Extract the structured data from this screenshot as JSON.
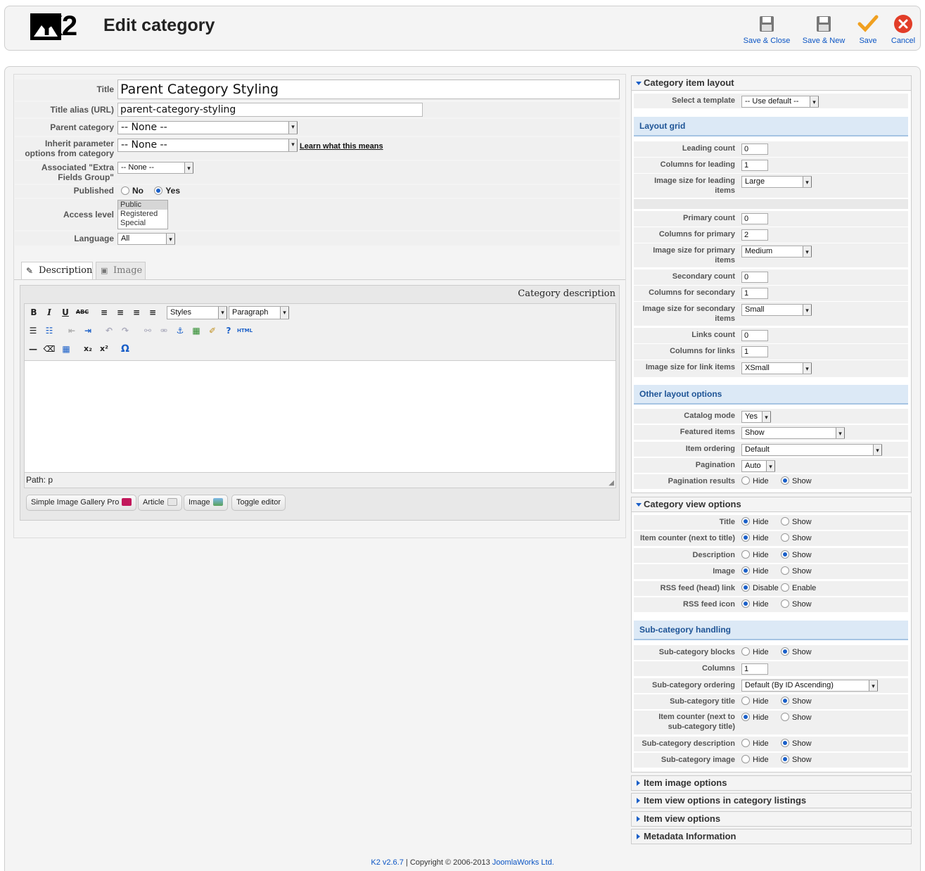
{
  "app": {
    "logo_text": "K2",
    "page_title": "Edit category"
  },
  "toolbar": [
    {
      "label": "Save & Close",
      "icon": "disk-icon"
    },
    {
      "label": "Save & New",
      "icon": "disk-icon"
    },
    {
      "label": "Save",
      "icon": "checkmark-icon"
    },
    {
      "label": "Cancel",
      "icon": "close-icon"
    }
  ],
  "colors": {
    "link": "#0b55c4",
    "radio_on": "#1a5fc8",
    "section_bg": "#dce9f6",
    "section_text": "#1e5496"
  },
  "form": {
    "title_label": "Title",
    "title_value": "Parent Category Styling",
    "alias_label": "Title alias (URL)",
    "alias_value": "parent-category-styling",
    "parent_label": "Parent category",
    "parent_value": "-- None --",
    "inherit_label_1": "Inherit parameter",
    "inherit_label_2": "options from category",
    "inherit_value": "-- None --",
    "learn_link": "Learn what this means",
    "extra_label_1": "Associated \"Extra",
    "extra_label_2": "Fields Group\"",
    "extra_value": "-- None --",
    "published_label": "Published",
    "published_no": "No",
    "published_yes": "Yes",
    "access_label": "Access level",
    "access_options": [
      "Public",
      "Registered",
      "Special"
    ],
    "language_label": "Language",
    "language_value": "All"
  },
  "tabs": {
    "description": "Description",
    "image": "Image"
  },
  "editor": {
    "desc_label": "Category description",
    "styles": "Styles",
    "format": "Paragraph",
    "path": "Path: p",
    "buttons": [
      "Simple Image Gallery Pro",
      "Article",
      "Image",
      "Toggle editor"
    ],
    "html_btn": "HTML"
  },
  "right": {
    "item_layout": {
      "header": "Category item layout",
      "template_label": "Select a template",
      "template_value": "-- Use default --"
    },
    "layout_grid": {
      "header": "Layout grid",
      "rows": [
        {
          "label": "Leading count",
          "type": "input",
          "value": "0"
        },
        {
          "label": "Columns for leading",
          "type": "input",
          "value": "1"
        },
        {
          "label": "Image size for leading items",
          "type": "select",
          "value": "Large"
        },
        {
          "label": "Primary count",
          "type": "input",
          "value": "0"
        },
        {
          "label": "Columns for primary",
          "type": "input",
          "value": "2"
        },
        {
          "label": "Image size for primary items",
          "type": "select",
          "value": "Medium"
        },
        {
          "label": "Secondary count",
          "type": "input",
          "value": "0"
        },
        {
          "label": "Columns for secondary",
          "type": "input",
          "value": "1"
        },
        {
          "label": "Image size for secondary items",
          "type": "select",
          "value": "Small"
        },
        {
          "label": "Links count",
          "type": "input",
          "value": "0"
        },
        {
          "label": "Columns for links",
          "type": "input",
          "value": "1"
        },
        {
          "label": "Image size for link items",
          "type": "select",
          "value": "XSmall"
        }
      ]
    },
    "other_layout": {
      "header": "Other layout options",
      "rows": [
        {
          "label": "Catalog mode",
          "value": "Yes"
        },
        {
          "label": "Featured items",
          "value": "Show"
        },
        {
          "label": "Item ordering",
          "value": "Default"
        },
        {
          "label": "Pagination",
          "value": "Auto"
        },
        {
          "label": "Pagination results",
          "opt1": "Hide",
          "opt2": "Show"
        }
      ]
    },
    "category_view": {
      "header": "Category view options",
      "rows": [
        {
          "label": "Title",
          "opt1": "Hide",
          "opt2": "Show",
          "sel": 1
        },
        {
          "label": "Item counter (next to title)",
          "opt1": "Hide",
          "opt2": "Show",
          "sel": 1
        },
        {
          "label": "Description",
          "opt1": "Hide",
          "opt2": "Show",
          "sel": 2
        },
        {
          "label": "Image",
          "opt1": "Hide",
          "opt2": "Show",
          "sel": 1
        },
        {
          "label": "RSS feed (head) link",
          "opt1": "Disable",
          "opt2": "Enable",
          "sel": 1
        },
        {
          "label": "RSS feed icon",
          "opt1": "Hide",
          "opt2": "Show",
          "sel": 1
        }
      ]
    },
    "subcat": {
      "header": "Sub-category handling",
      "blocks_label": "Sub-category blocks",
      "columns_label": "Columns",
      "columns_value": "1",
      "ordering_label": "Sub-category ordering",
      "ordering_value": "Default (By ID Ascending)",
      "title_label": "Sub-category title",
      "counter_label_1": "Item counter (next to",
      "counter_label_2": "sub-category title)",
      "desc_label": "Sub-category description",
      "image_label": "Sub-category image",
      "hide": "Hide",
      "show": "Show"
    },
    "collapsed": [
      "Item image options",
      "Item view options in category listings",
      "Item view options",
      "Metadata Information"
    ]
  },
  "footer": {
    "version": "K2 v2.6.7",
    "sep": " | Copyright © 2006-2013 ",
    "company": "JoomlaWorks Ltd."
  }
}
